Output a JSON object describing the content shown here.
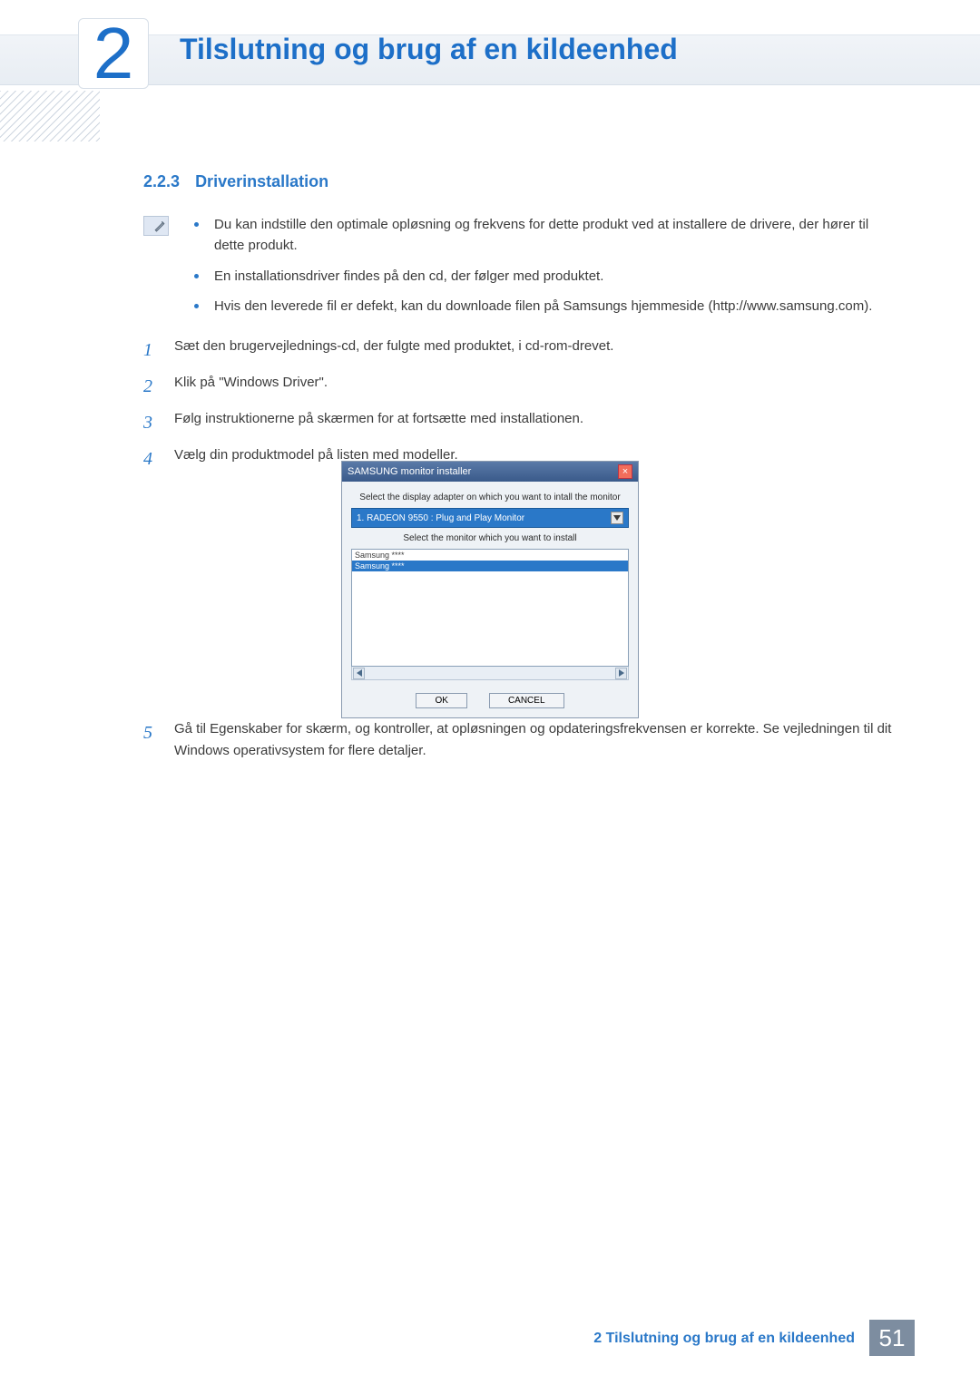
{
  "header": {
    "chapter_number": "2",
    "title": "Tilslutning og brug af en kildeenhed"
  },
  "section": {
    "number": "2.2.3",
    "title": "Driverinstallation"
  },
  "note_bullets": [
    "Du kan indstille den optimale opløsning og frekvens for dette produkt ved at installere de drivere, der hører til dette produkt.",
    "En installationsdriver findes på den cd, der følger med produktet.",
    "Hvis den leverede fil er defekt, kan du downloade filen på Samsungs hjemmeside (http://www.samsung.com)."
  ],
  "steps": {
    "s1": {
      "n": "1",
      "t": "Sæt den brugervejlednings-cd, der fulgte med produktet, i cd-rom-drevet."
    },
    "s2": {
      "n": "2",
      "t": "Klik på \"Windows Driver\"."
    },
    "s3": {
      "n": "3",
      "t": "Følg instruktionerne på skærmen for at fortsætte med installationen."
    },
    "s4": {
      "n": "4",
      "t": "Vælg din produktmodel på listen med modeller."
    },
    "s5": {
      "n": "5",
      "t": "Gå til Egenskaber for skærm, og kontroller, at opløsningen og opdateringsfrekvensen er korrekte. Se vejledningen til dit Windows operativsystem for flere detaljer."
    }
  },
  "dialog": {
    "title": "SAMSUNG monitor installer",
    "close": "×",
    "label_adapter": "Select the display adapter on which you want to intall the monitor",
    "combo_value": "1. RADEON 9550 : Plug and Play Monitor",
    "label_monitor": "Select the monitor which you want to install",
    "list_item0": "Samsung ****",
    "list_item1": "Samsung ****",
    "ok": "OK",
    "cancel": "CANCEL"
  },
  "footer": {
    "title": "2 Tilslutning og brug af en kildeenhed",
    "page": "51"
  }
}
